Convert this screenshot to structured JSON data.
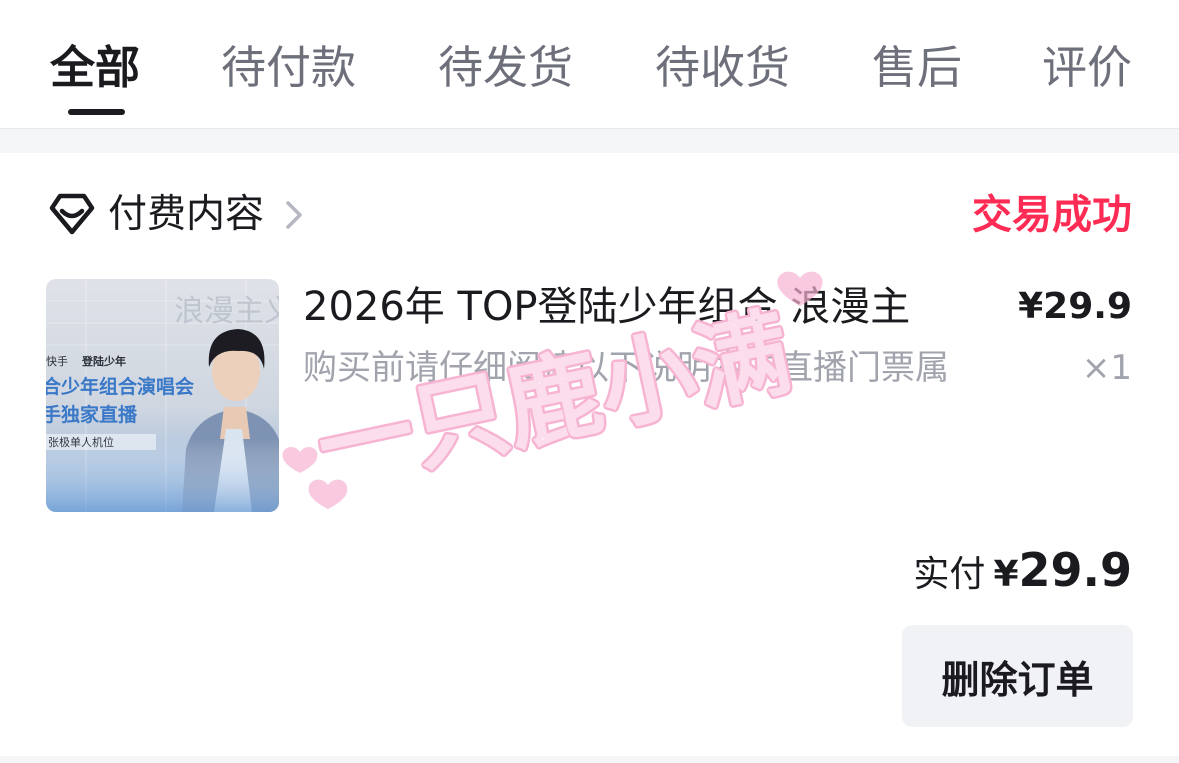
{
  "tabs": [
    {
      "label": "全部",
      "active": true
    },
    {
      "label": "待付款",
      "active": false
    },
    {
      "label": "待发货",
      "active": false
    },
    {
      "label": "待收货",
      "active": false
    },
    {
      "label": "售后",
      "active": false
    },
    {
      "label": "评价",
      "active": false
    }
  ],
  "order": {
    "store_icon": "diamond-tag-icon",
    "store_name": "付费内容",
    "status": "交易成功",
    "status_color": "#fe2c55",
    "thumbnail": {
      "icon": "product-thumbnail",
      "lines": [
        "快手",
        "登陆少年",
        "合少年组合演唱会",
        "手独家直播",
        "张极单人机位",
        "浪漫主义"
      ]
    },
    "item_title": "2026年 TOP登陆少年组合 浪漫主",
    "item_price": "¥29.9",
    "item_desc": "购买前请仔细阅读以下说明本次直播门票属",
    "quantity": "×1",
    "paid_label": "实付",
    "paid_currency": "¥",
    "paid_amount": "29.9",
    "delete_button": "删除订单"
  },
  "watermark": {
    "text": "一只鹿小满",
    "color": "#f7b4d2"
  }
}
